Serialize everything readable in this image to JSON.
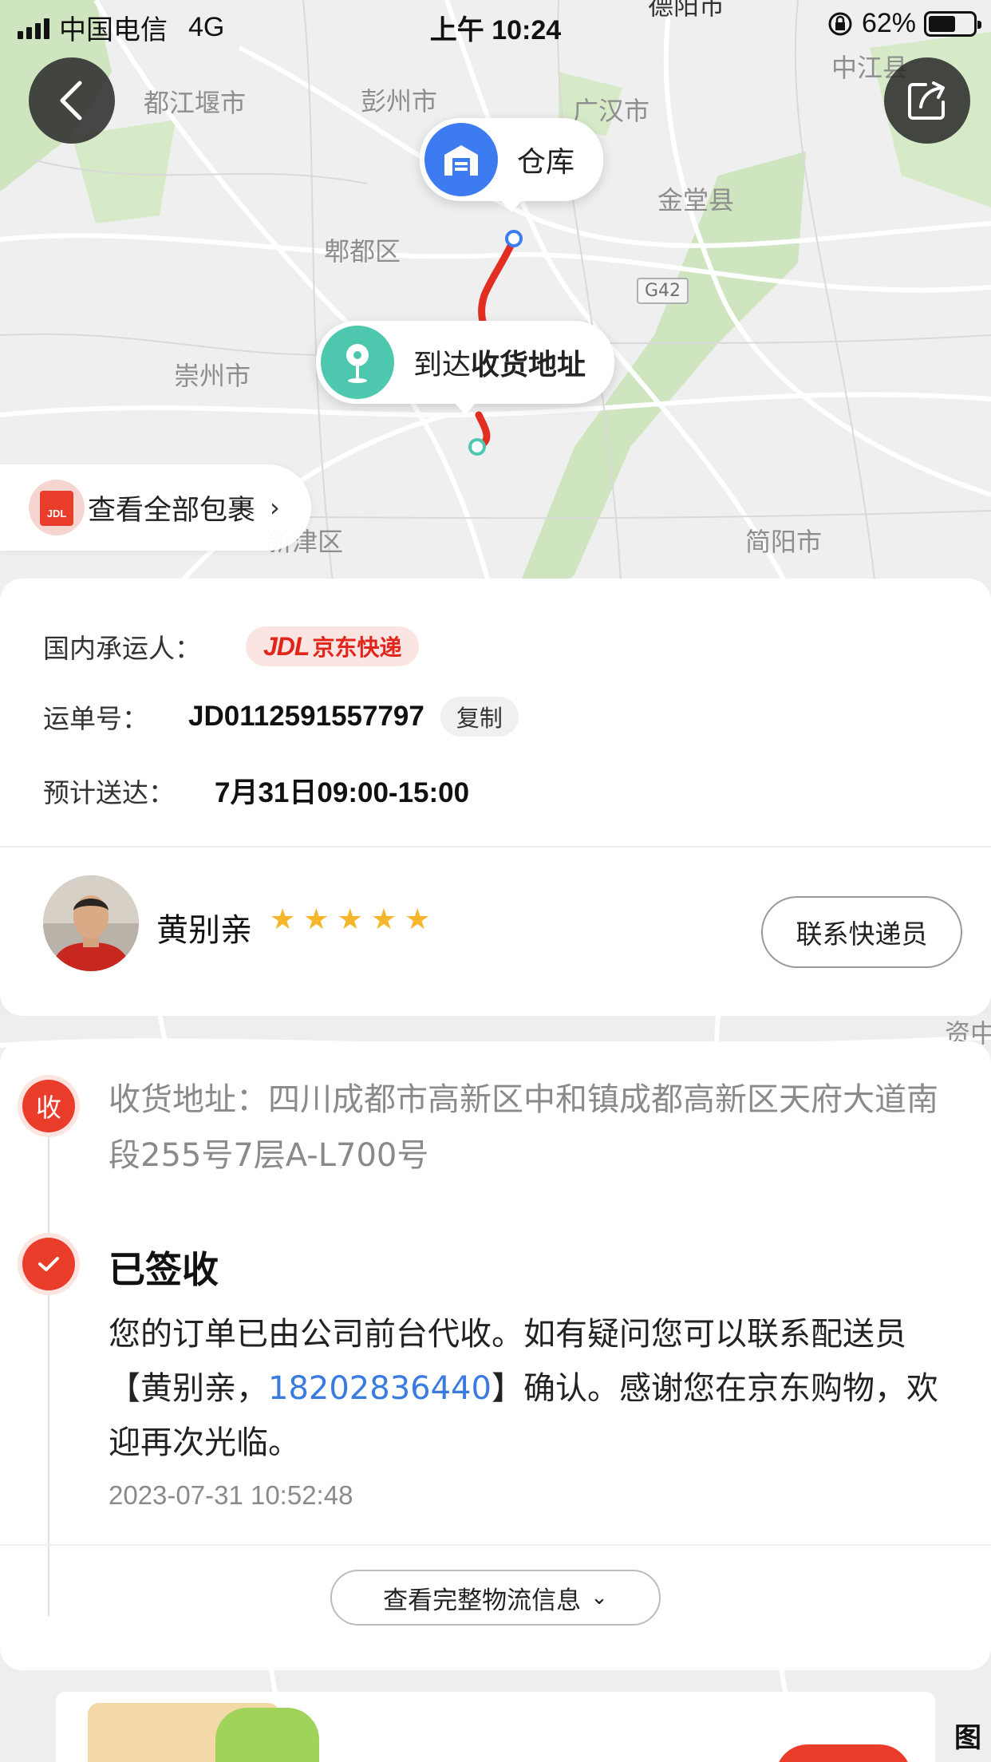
{
  "status_bar": {
    "carrier": "中国电信",
    "network": "4G",
    "time": "上午 10:24",
    "battery_text": "62%",
    "battery_level": 0.62
  },
  "map": {
    "cities": [
      "德阳市",
      "都江堰市",
      "彭州市",
      "广汉市",
      "中江县",
      "金堂县",
      "郫都区",
      "崇州市",
      "新津区",
      "简阳市",
      "资中"
    ],
    "road": "G42",
    "warehouse_label": "仓库",
    "arrive_prefix": "到达",
    "arrive_bold": "收货地址",
    "packages_link": "查看全部包裹",
    "packages_icon_text": "JDL",
    "legend_partial": "图"
  },
  "shipment": {
    "carrier_label": "国内承运人：",
    "carrier_logo": "JDL",
    "carrier_name": "京东快递",
    "waybill_label": "运单号：",
    "waybill_number": "JD0112591557797",
    "copy_label": "复制",
    "eta_label": "预计送达：",
    "eta_value": "7月31日09:00-15:00"
  },
  "courier": {
    "name": "黄别亲",
    "rating": 5,
    "contact_label": "联系快递员"
  },
  "timeline": {
    "receive_badge": "收",
    "address": "收货地址：四川成都市高新区中和镇成都高新区天府大道南段255号7层A-L700号",
    "signed_title": "已签收",
    "desc_part1": "您的订单已由公司前台代收。如有疑问您可以联系配送员【黄别亲，",
    "phone": "18202836440",
    "desc_part2": "】确认。感谢您在京东购物，欢迎再次光临。",
    "timestamp": "2023-07-31 10:52:48",
    "more_label": "查看完整物流信息"
  },
  "colors": {
    "accent_red": "#e93c2b",
    "link_blue": "#3a7be0",
    "star_yellow": "#f7b52c",
    "warehouse_blue": "#3d7bf0",
    "arrive_teal": "#4dc8ae"
  }
}
